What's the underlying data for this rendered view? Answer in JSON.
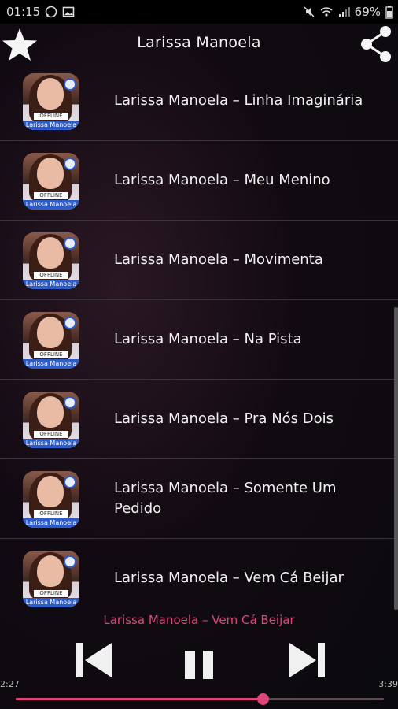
{
  "status_bar": {
    "time": "01:15",
    "battery": "69%"
  },
  "app_bar": {
    "title": "Larissa Manoela"
  },
  "songs": [
    {
      "title": "Larissa Manoela – Linha Imaginária"
    },
    {
      "title": "Larissa Manoela – Meu Menino"
    },
    {
      "title": "Larissa Manoela – Movimenta"
    },
    {
      "title": "Larissa Manoela – Na Pista"
    },
    {
      "title": "Larissa Manoela – Pra Nós Dois"
    },
    {
      "title": "Larissa Manoela – Somente Um Pedido"
    },
    {
      "title": "Larissa Manoela – Vem Cá Beijar"
    }
  ],
  "thumb": {
    "tag": "OFFLINE",
    "band": "Larissa Manoela"
  },
  "player": {
    "now_playing": "Larissa Manoela – Vem Cá Beijar",
    "elapsed": "2:27",
    "duration": "3:39",
    "progress": 0.67,
    "accent_color": "#e0457a"
  },
  "icons": {
    "favorite": "star-icon",
    "share": "share-icon",
    "previous": "skip-previous-icon",
    "pause": "pause-icon",
    "next": "skip-next-icon"
  }
}
